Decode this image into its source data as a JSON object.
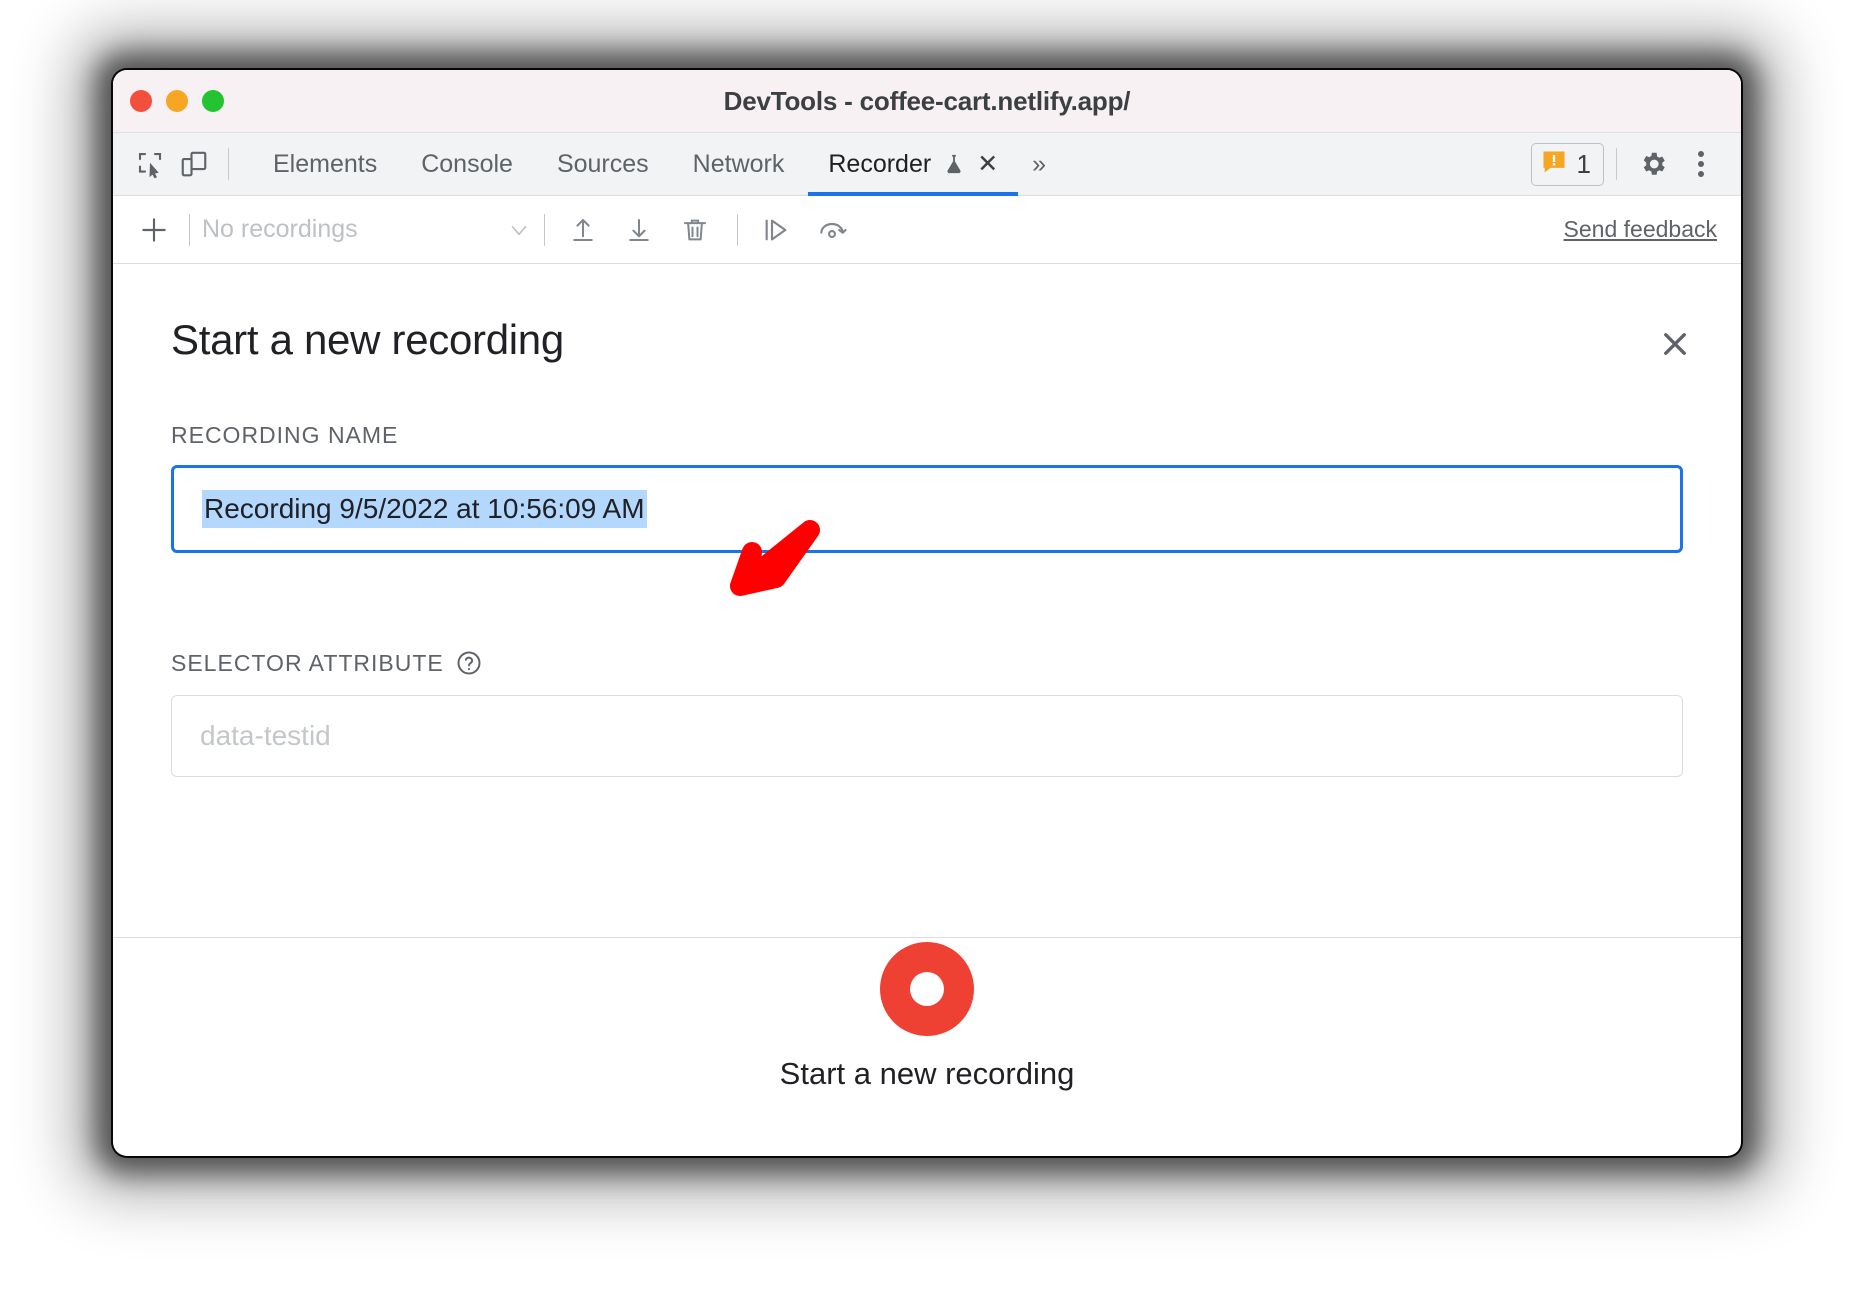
{
  "window": {
    "title": "DevTools - coffee-cart.netlify.app/",
    "traffic_lights": [
      "close",
      "minimize",
      "zoom"
    ],
    "colors": {
      "close": "#f2503c",
      "minimize": "#f5a623",
      "zoom": "#23c332",
      "accent_blue": "#1a73e8",
      "record_red": "#ee4134",
      "selection_blue": "#b3d7fd",
      "warning_orange": "#f5a623",
      "annotation_red": "#ff0000"
    }
  },
  "toolbar_left": {
    "inspect_icon": "inspect-element-icon",
    "device_icon": "device-toolbar-icon"
  },
  "tabs": [
    {
      "label": "Elements",
      "active": false
    },
    {
      "label": "Console",
      "active": false
    },
    {
      "label": "Sources",
      "active": false
    },
    {
      "label": "Network",
      "active": false
    },
    {
      "label": "Recorder",
      "active": true,
      "experiment_icon": "flask-icon",
      "close_label": "✕"
    }
  ],
  "tabs_overflow": "»",
  "toolbar_right": {
    "warning_count": "1",
    "warning_icon": "warning-badge-icon",
    "settings_icon": "gear-icon",
    "more_icon": "more-vertical-icon"
  },
  "recorder_toolbar": {
    "add_label": "+",
    "recordings_select_value": "No recordings",
    "chevron": "chevron-down-icon",
    "import_icon": "import-icon",
    "export_icon": "export-icon",
    "delete_icon": "trash-icon",
    "step_icon": "step-icon",
    "replay_icon": "replay-icon",
    "feedback_label": "Send feedback"
  },
  "panel": {
    "heading": "Start a new recording",
    "close_label": "✕",
    "recording_name": {
      "label": "Recording name",
      "value": "Recording 9/5/2022 at 10:56:09 AM"
    },
    "selector_attribute": {
      "label": "Selector attribute",
      "help_icon": "help-circle-icon",
      "placeholder": "data-testid",
      "value": ""
    },
    "footer": {
      "record_icon": "record-circle-icon",
      "record_label": "Start a new recording"
    }
  },
  "annotation": {
    "arrow": "red-arrow-pointing-down-left",
    "target": "recording-name-input"
  }
}
